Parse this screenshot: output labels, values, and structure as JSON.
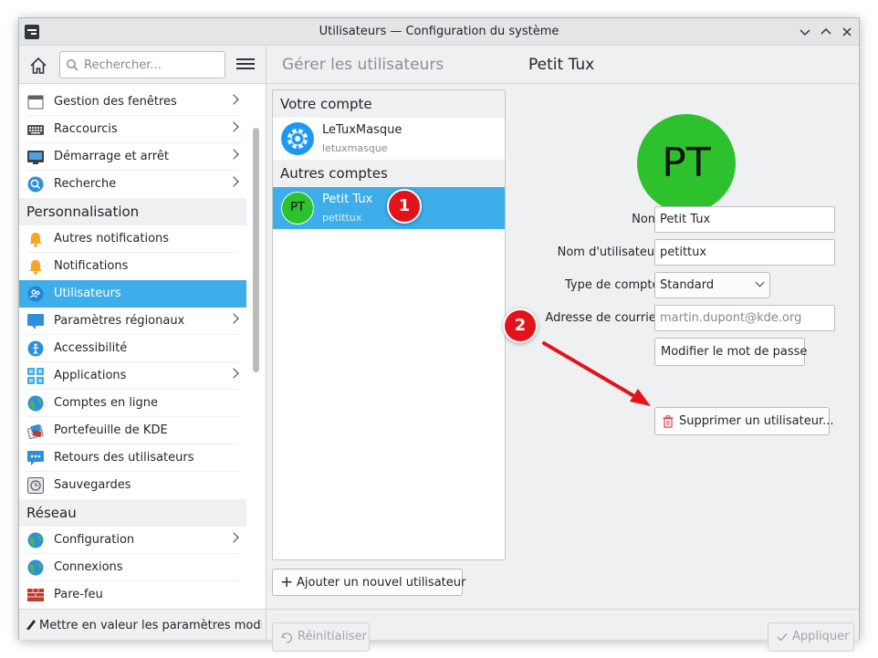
{
  "window": {
    "title": "Utilisateurs — Configuration du système"
  },
  "sidebar_header": {
    "search_placeholder": "Rechercher..."
  },
  "sidebar": {
    "items": [
      {
        "label": "Gestion des fenêtres",
        "icon": "window-management-icon",
        "chevron": true
      },
      {
        "label": "Raccourcis",
        "icon": "keyboard-icon",
        "chevron": true
      },
      {
        "label": "Démarrage et arrêt",
        "icon": "startup-icon",
        "chevron": true
      },
      {
        "label": "Recherche",
        "icon": "search-blue-icon",
        "chevron": true
      },
      {
        "category": "Personnalisation"
      },
      {
        "label": "Autres notifications",
        "icon": "bell-icon",
        "chevron": false
      },
      {
        "label": "Notifications",
        "icon": "bell-icon",
        "chevron": false
      },
      {
        "label": "Utilisateurs",
        "icon": "users-icon",
        "chevron": false,
        "selected": true
      },
      {
        "label": "Paramètres régionaux",
        "icon": "regional-icon",
        "chevron": true
      },
      {
        "label": "Accessibilité",
        "icon": "accessibility-icon",
        "chevron": false
      },
      {
        "label": "Applications",
        "icon": "applications-icon",
        "chevron": true
      },
      {
        "label": "Comptes en ligne",
        "icon": "globe-icon",
        "chevron": false
      },
      {
        "label": "Portefeuille de KDE",
        "icon": "wallet-icon",
        "chevron": false
      },
      {
        "label": "Retours des utilisateurs",
        "icon": "feedback-icon",
        "chevron": false
      },
      {
        "label": "Sauvegardes",
        "icon": "backup-icon",
        "chevron": false
      },
      {
        "category": "Réseau"
      },
      {
        "label": "Configuration",
        "icon": "globe-icon",
        "chevron": true
      },
      {
        "label": "Connexions",
        "icon": "globe-icon",
        "chevron": false
      },
      {
        "label": "Pare-feu",
        "icon": "firewall-icon",
        "chevron": false
      }
    ],
    "footer_label": "Mettre en valeur les paramètres modifiés"
  },
  "header": {
    "breadcrumb_parent": "Gérer les utilisateurs",
    "breadcrumb_current": "Petit Tux"
  },
  "users": {
    "your_account_heading": "Votre compte",
    "your_account": {
      "name": "LeTuxMasque",
      "login": "letuxmasque"
    },
    "other_accounts_heading": "Autres comptes",
    "other_accounts": [
      {
        "name": "Petit Tux",
        "login": "petittux",
        "initials": "PT"
      }
    ],
    "add_button": "Ajouter un nouvel utilisateur"
  },
  "details": {
    "avatar_initials": "PT",
    "name_label": "Nom :",
    "name_value": "Petit Tux",
    "username_label": "Nom d'utilisateur :",
    "username_value": "petittux",
    "account_type_label": "Type de compte :",
    "account_type_value": "Standard",
    "email_label": "Adresse de courriel :",
    "email_placeholder": "martin.dupont@kde.org",
    "change_password_button": "Modifier le mot de passe",
    "delete_user_button": "Supprimer un utilisateur..."
  },
  "footer": {
    "reset_button": "Réinitialiser",
    "apply_button": "Appliquer"
  },
  "annotations": {
    "badge1": "1",
    "badge2": "2"
  },
  "colors": {
    "selection": "#3daee9",
    "avatar_green": "#2dc22d",
    "annotation_red": "#e3131b"
  }
}
